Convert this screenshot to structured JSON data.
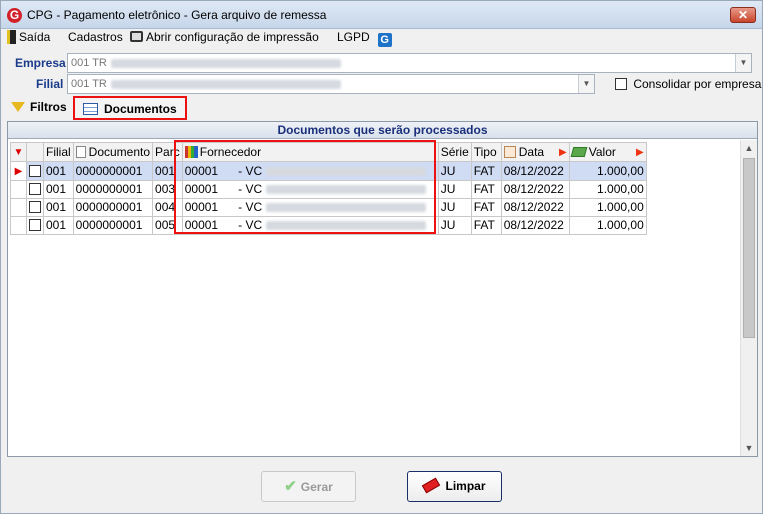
{
  "window": {
    "title": "CPG -  Pagamento eletrônico - Gera arquivo de remessa",
    "close_symbol": "✕"
  },
  "menu": {
    "items": [
      "Saída",
      "Cadastros",
      "Abrir configuração de impressão",
      "LGPD"
    ]
  },
  "empresa": {
    "label": "Empresa",
    "value": "001 TR"
  },
  "filial": {
    "label": "Filial",
    "value": "001 TR"
  },
  "consolidar": {
    "label": "Consolidar por empresa",
    "checked": false
  },
  "tabs": [
    {
      "label": "Filtros",
      "icon": "funnel-icon",
      "active": false
    },
    {
      "label": "Documentos",
      "icon": "grid-icon",
      "active": true
    }
  ],
  "panel": {
    "title": "Documentos que serão processados"
  },
  "table": {
    "columns": [
      "Filial",
      "Documento",
      "Parc",
      "Fornecedor",
      "Série",
      "Tipo",
      "Data",
      "Valor"
    ],
    "rows": [
      {
        "filial": "001",
        "documento": "0000000001",
        "parc": "001",
        "fornecedor_code": "00001",
        "fornecedor_name": "- VC",
        "serie": "JU",
        "tipo": "FAT",
        "data": "08/12/2022",
        "valor": "1.000,00",
        "selected": true,
        "checked": false
      },
      {
        "filial": "001",
        "documento": "0000000001",
        "parc": "003",
        "fornecedor_code": "00001",
        "fornecedor_name": "- VC",
        "serie": "JU",
        "tipo": "FAT",
        "data": "08/12/2022",
        "valor": "1.000,00",
        "selected": false,
        "checked": false
      },
      {
        "filial": "001",
        "documento": "0000000001",
        "parc": "004",
        "fornecedor_code": "00001",
        "fornecedor_name": "- VC",
        "serie": "JU",
        "tipo": "FAT",
        "data": "08/12/2022",
        "valor": "1.000,00",
        "selected": false,
        "checked": false
      },
      {
        "filial": "001",
        "documento": "0000000001",
        "parc": "005",
        "fornecedor_code": "00001",
        "fornecedor_name": "- VC",
        "serie": "JU",
        "tipo": "FAT",
        "data": "08/12/2022",
        "valor": "1.000,00",
        "selected": false,
        "checked": false
      }
    ]
  },
  "buttons": {
    "gerar": "Gerar",
    "limpar": "Limpar",
    "gerar_enabled": false
  },
  "colors": {
    "highlight_red": "#ee1111",
    "selected_row": "#cfdcf4",
    "panel_title": "#1a2f7a"
  }
}
